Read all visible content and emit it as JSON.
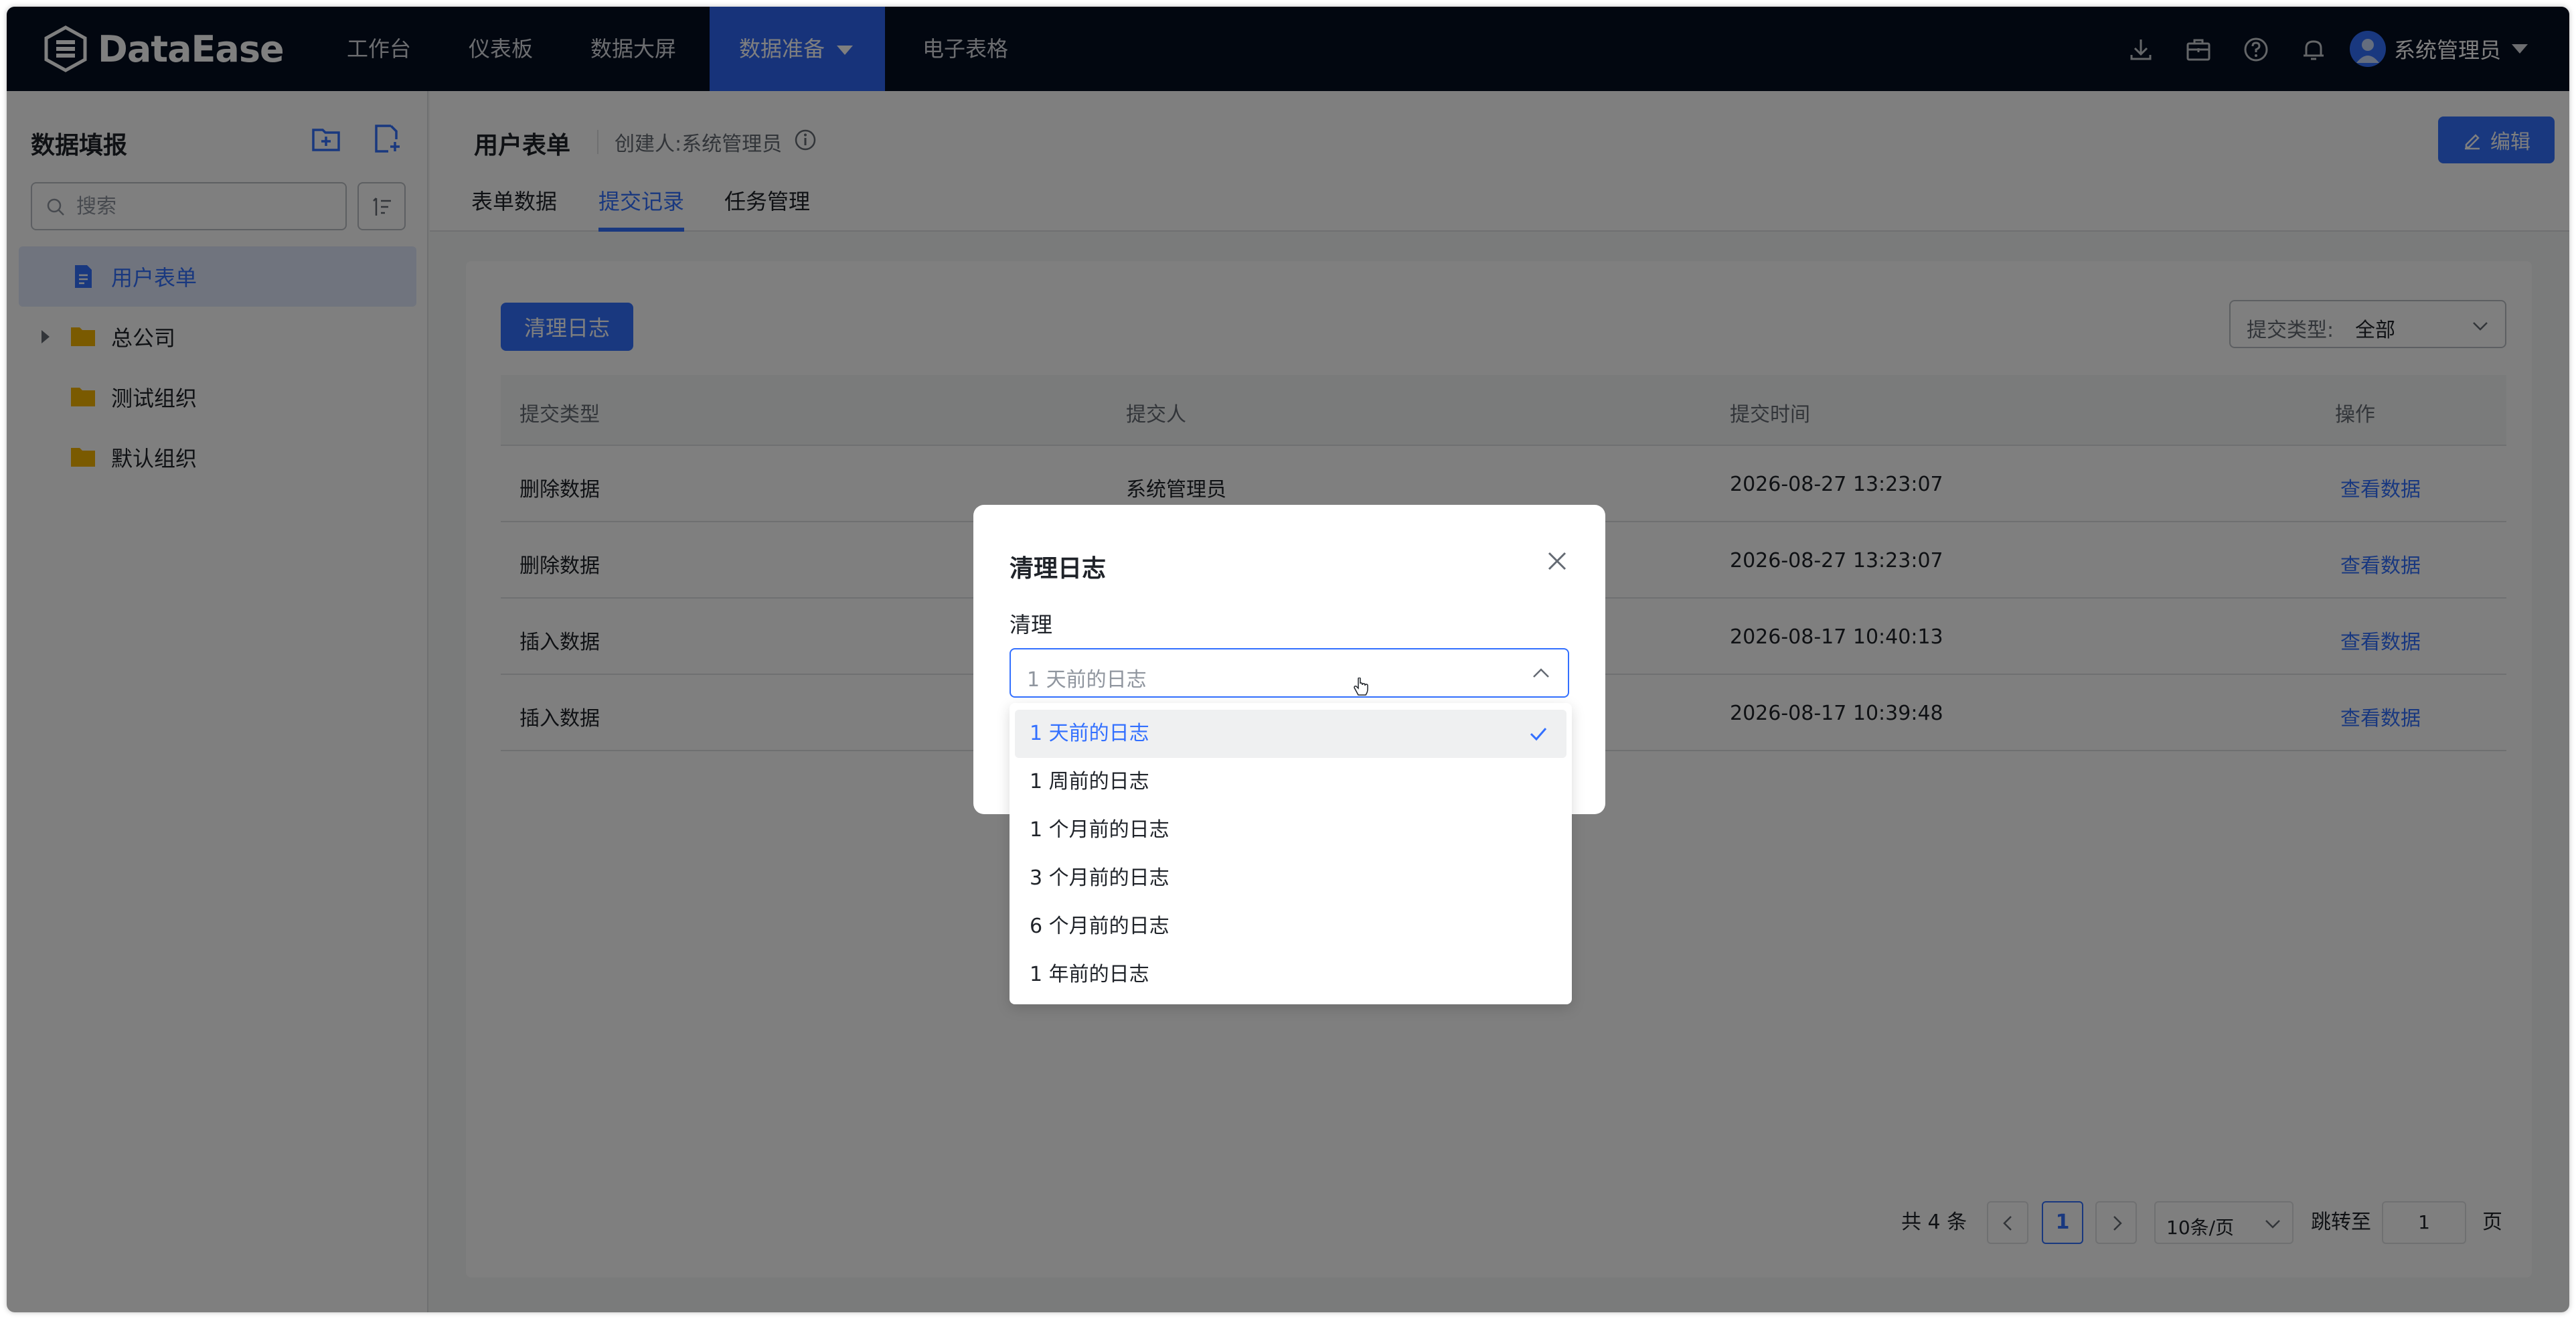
{
  "app": {
    "logo_text": "DataEase"
  },
  "nav": {
    "items": [
      "工作台",
      "仪表板",
      "数据大屏",
      "数据准备",
      "电子表格"
    ],
    "active": "数据准备"
  },
  "topbar": {
    "icons": [
      "download-icon",
      "briefcase-icon",
      "help-icon",
      "bell-icon"
    ],
    "user_name": "系统管理员"
  },
  "sidebar": {
    "title": "数据填报",
    "search_placeholder": "搜索",
    "items": [
      {
        "label": "用户表单",
        "icon": "document-icon",
        "active": true
      },
      {
        "label": "总公司",
        "icon": "folder-icon",
        "expandable": true
      },
      {
        "label": "测试组织",
        "icon": "folder-icon"
      },
      {
        "label": "默认组织",
        "icon": "folder-icon"
      }
    ]
  },
  "header": {
    "title": "用户表单",
    "creator": "创建人:系统管理员",
    "edit_label": "编辑",
    "tabs": [
      "表单数据",
      "提交记录",
      "任务管理"
    ],
    "active_tab": "提交记录"
  },
  "content": {
    "clear_log_label": "清理日志",
    "submit_type_label": "提交类型:",
    "submit_type_value": "全部",
    "columns": [
      "提交类型",
      "提交人",
      "提交时间",
      "操作"
    ],
    "rows": [
      {
        "type": "删除数据",
        "submitter": "系统管理员",
        "time": "2026-08-27 13:23:07",
        "action": "查看数据"
      },
      {
        "type": "删除数据",
        "submitter": "",
        "time": "2026-08-27 13:23:07",
        "action": "查看数据"
      },
      {
        "type": "插入数据",
        "submitter": "",
        "time": "2026-08-17 10:40:13",
        "action": "查看数据"
      },
      {
        "type": "插入数据",
        "submitter": "",
        "time": "2026-08-17 10:39:48",
        "action": "查看数据"
      }
    ],
    "pagination": {
      "total": "共 4 条",
      "current_page": "1",
      "page_size": "10条/页",
      "jump_label": "跳转至",
      "jump_value": "1",
      "page_suffix": "页"
    }
  },
  "dialog": {
    "title": "清理日志",
    "field_label": "清理",
    "placeholder": "1 天前的日志",
    "options": [
      "1 天前的日志",
      "1 周前的日志",
      "1 个月前的日志",
      "3 个月前的日志",
      "6 个月前的日志",
      "1 年前的日志"
    ],
    "selected_index": 0
  },
  "colors": {
    "accent": "#3370ff",
    "topbar": "#050e21",
    "folder": "#f5a623"
  }
}
